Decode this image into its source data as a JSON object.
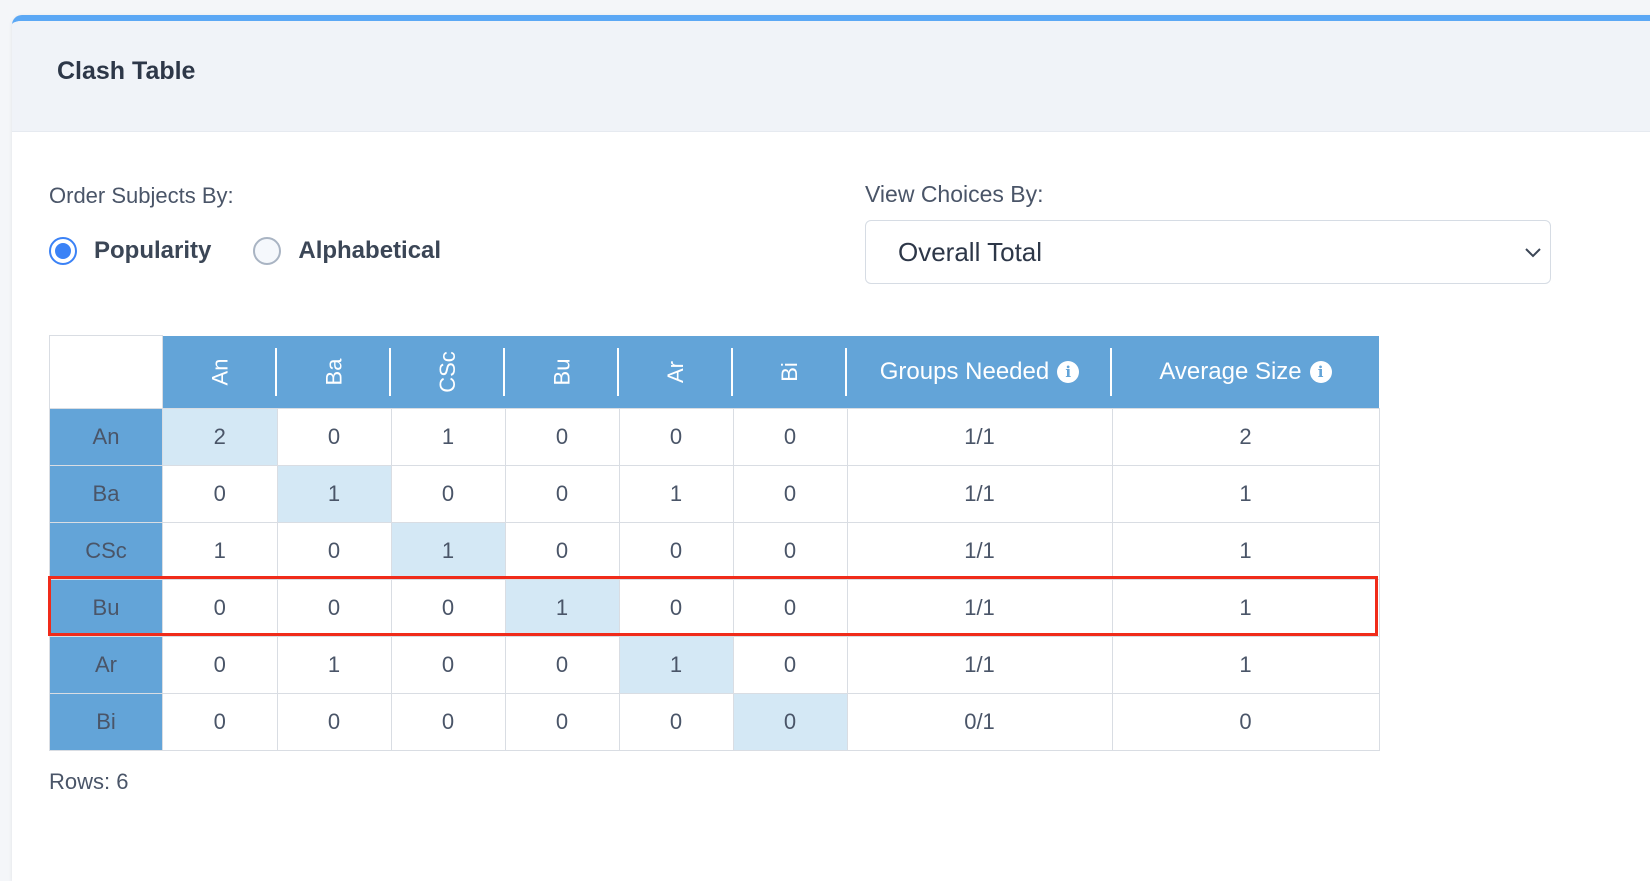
{
  "header": {
    "title": "Clash Table"
  },
  "order": {
    "label": "Order Subjects By:",
    "options": [
      {
        "label": "Popularity",
        "checked": true
      },
      {
        "label": "Alphabetical",
        "checked": false
      }
    ]
  },
  "view": {
    "label": "View Choices By:",
    "selected": "Overall Total"
  },
  "table": {
    "subjects": [
      "An",
      "Ba",
      "CSc",
      "Bu",
      "Ar",
      "Bi"
    ],
    "groups_header": "Groups Needed",
    "avg_header": "Average Size",
    "rows": [
      {
        "head": "An",
        "cells": [
          "2",
          "0",
          "1",
          "0",
          "0",
          "0"
        ],
        "groups": "1/1",
        "avg": "2"
      },
      {
        "head": "Ba",
        "cells": [
          "0",
          "1",
          "0",
          "0",
          "1",
          "0"
        ],
        "groups": "1/1",
        "avg": "1"
      },
      {
        "head": "CSc",
        "cells": [
          "1",
          "0",
          "1",
          "0",
          "0",
          "0"
        ],
        "groups": "1/1",
        "avg": "1"
      },
      {
        "head": "Bu",
        "cells": [
          "0",
          "0",
          "0",
          "1",
          "0",
          "0"
        ],
        "groups": "1/1",
        "avg": "1"
      },
      {
        "head": "Ar",
        "cells": [
          "0",
          "1",
          "0",
          "0",
          "1",
          "0"
        ],
        "groups": "1/1",
        "avg": "1"
      },
      {
        "head": "Bi",
        "cells": [
          "0",
          "0",
          "0",
          "0",
          "0",
          "0"
        ],
        "groups": "0/1",
        "avg": "0"
      }
    ],
    "highlighted_row": "Bu"
  },
  "footer": {
    "rows_label": "Rows: 6"
  },
  "colors": {
    "accent": "#5ba8f5",
    "header_cell": "#63a4d8",
    "diagonal": "#d4e8f5",
    "highlight": "#f02b1a",
    "radio_checked": "#3b82f6"
  }
}
